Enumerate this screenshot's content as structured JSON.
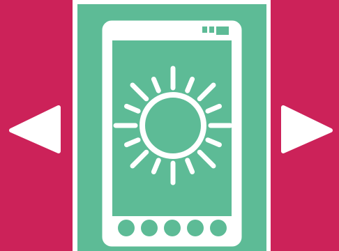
{
  "colors": {
    "side_panel": "#cc2259",
    "center_panel": "#5dbb96",
    "foreground": "#ffffff"
  },
  "icons": {
    "prev": "arrow-left-icon",
    "next": "arrow-right-icon",
    "device": "smartphone-icon",
    "symbol": "sun-brightness-icon"
  },
  "phone": {
    "nav_dot_count": 5
  }
}
